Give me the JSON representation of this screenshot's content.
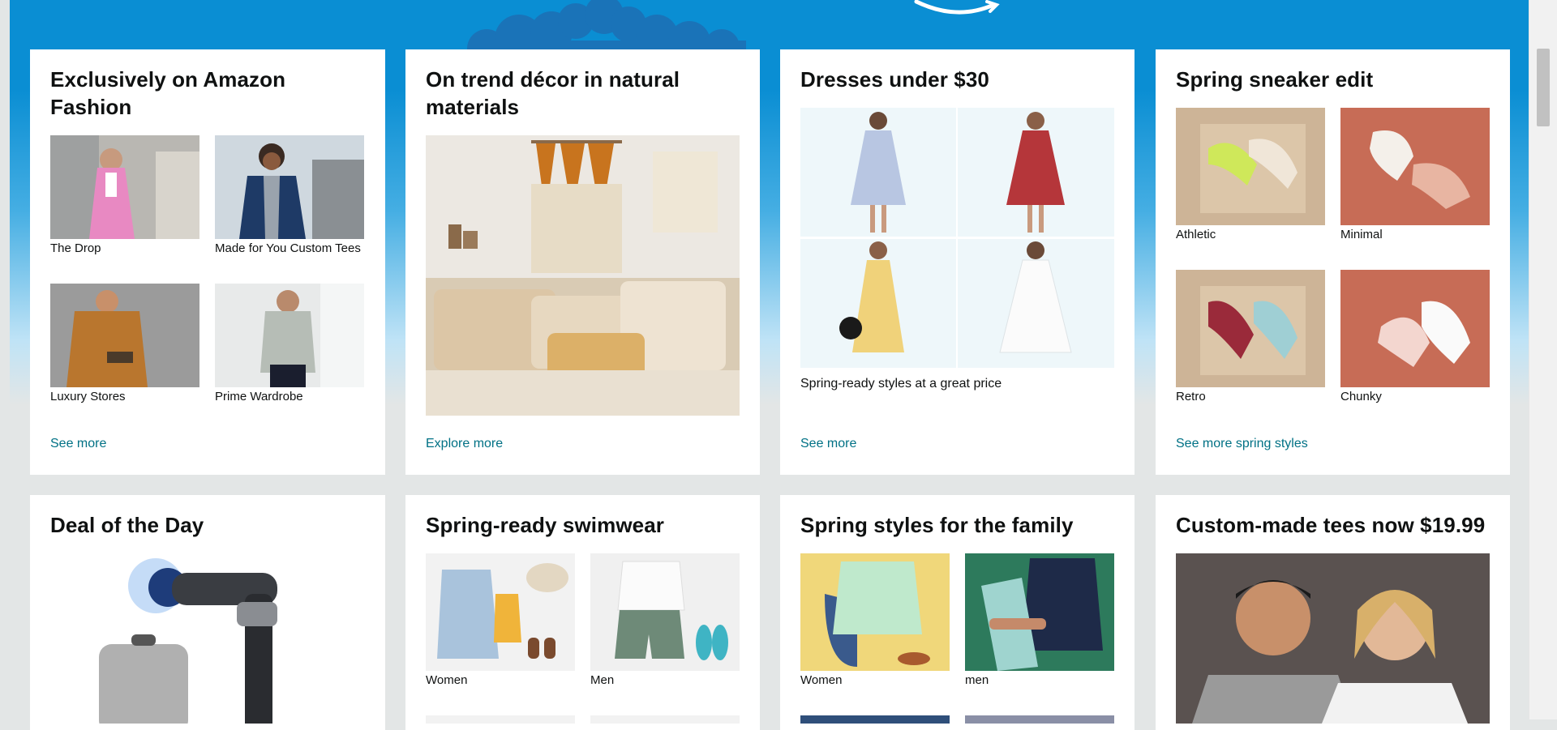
{
  "colors": {
    "hero_blue": "#0a8ed3",
    "link": "#007185",
    "text": "#0f1111",
    "card": "#ffffff",
    "page_bg": "#e3e6e6"
  },
  "cards": [
    {
      "title": "Exclusively on Amazon Fashion",
      "items": [
        "The Drop",
        "Made for You Custom Tees",
        "Luxury Stores",
        "Prime Wardrobe"
      ],
      "link": "See more"
    },
    {
      "title": "On trend décor in natural materials",
      "link": "Explore more"
    },
    {
      "title": "Dresses under $30",
      "subtitle": "Spring-ready styles at a great price",
      "link": "See more"
    },
    {
      "title": "Spring sneaker edit",
      "items": [
        "Athletic",
        "Minimal",
        "Retro",
        "Chunky"
      ],
      "link": "See more spring styles"
    },
    {
      "title": "Deal of the Day"
    },
    {
      "title": "Spring-ready swimwear",
      "items": [
        "Women",
        "Men"
      ]
    },
    {
      "title": "Spring styles for the family",
      "items": [
        "Women",
        "men"
      ]
    },
    {
      "title": "Custom-made tees now $19.99"
    }
  ]
}
